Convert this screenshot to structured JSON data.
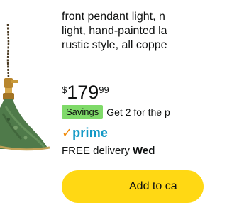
{
  "product": {
    "title_lines": [
      "front pendant light, n",
      "light, hand-painted la",
      "rustic style, all coppe"
    ],
    "price": {
      "currency": "$",
      "whole": "179",
      "fraction": "99"
    },
    "deal": {
      "badge": "Savings",
      "text": "Get 2 for the p"
    },
    "prime": {
      "check": "✓",
      "label": "prime"
    },
    "delivery": {
      "prefix": "FREE delivery ",
      "day": "Wed"
    },
    "add_to_cart_label": "Add to ca"
  },
  "colors": {
    "savings_badge": "#7fda69",
    "prime_blue": "#1399c6",
    "prime_check": "#f08804",
    "button_yellow": "#ffd814"
  },
  "icons": {
    "product_image": "pendant-lamp-image",
    "prime_logo": "prime-check-icon"
  }
}
